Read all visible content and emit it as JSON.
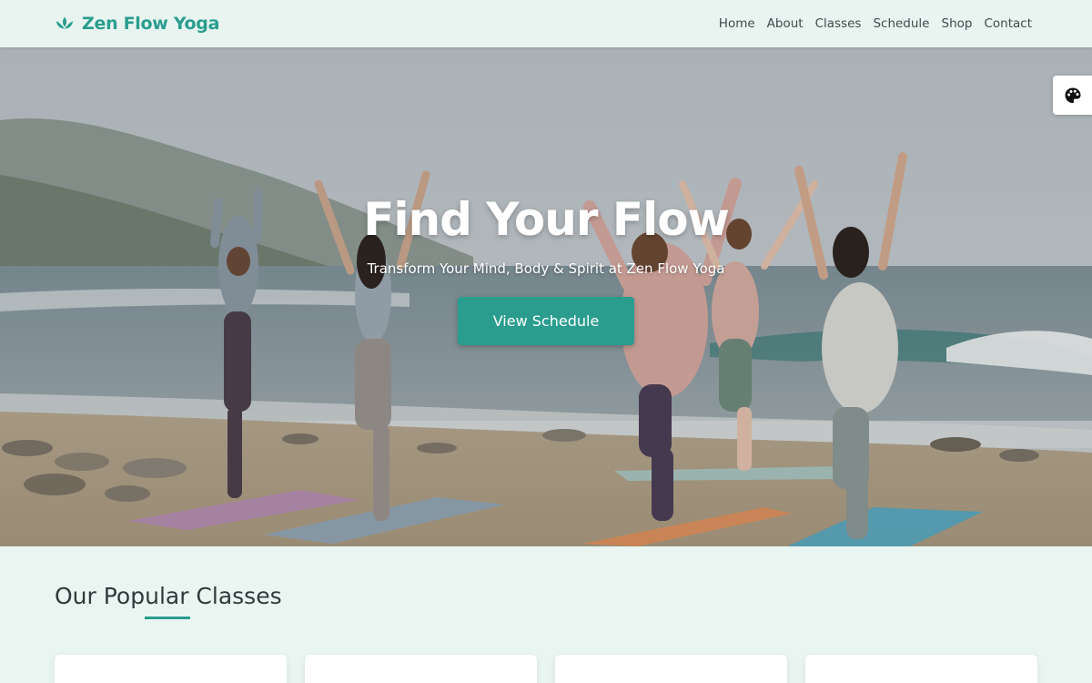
{
  "brand": {
    "name": "Zen Flow Yoga",
    "logo_icon": "lotus-icon",
    "color": "#2a9d8f"
  },
  "nav": {
    "items": [
      {
        "label": "Home"
      },
      {
        "label": "About"
      },
      {
        "label": "Classes"
      },
      {
        "label": "Schedule"
      },
      {
        "label": "Shop"
      },
      {
        "label": "Contact"
      }
    ]
  },
  "hero": {
    "title": "Find Your Flow",
    "subtitle": "Transform Your Mind, Body & Spirit at Zen Flow Yoga",
    "cta_label": "View Schedule"
  },
  "theme_toggle": {
    "icon": "palette-icon"
  },
  "classes_section": {
    "title": "Our Popular Classes",
    "card_count_visible": 4
  }
}
